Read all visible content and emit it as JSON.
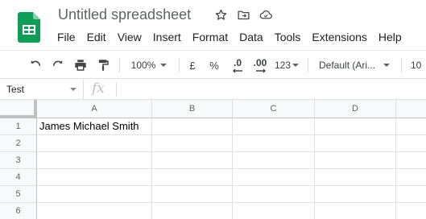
{
  "app": {
    "doc_title": "Untitled spreadsheet",
    "brand_color": "#0f9d58",
    "title_icons": [
      "star-icon",
      "move-to-folder-icon",
      "cloud-status-icon"
    ]
  },
  "menu": {
    "file": "File",
    "edit": "Edit",
    "view": "View",
    "insert": "Insert",
    "format": "Format",
    "data": "Data",
    "tools": "Tools",
    "extensions": "Extensions",
    "help": "Help"
  },
  "toolbar": {
    "zoom": "100%",
    "currency": "£",
    "percent": "%",
    "decrease_decimals": ".0",
    "increase_decimals": ".00",
    "more_formats": "123",
    "font": "Default (Ari...",
    "font_size": "10"
  },
  "formula_bar": {
    "name_box": "Test",
    "fx_label": "fx",
    "formula": ""
  },
  "grid": {
    "columns": [
      "A",
      "B",
      "C",
      "D"
    ],
    "rows": [
      "1",
      "2",
      "3",
      "4",
      "5",
      "6"
    ],
    "cells": {
      "A1": "James Michael Smith"
    }
  }
}
